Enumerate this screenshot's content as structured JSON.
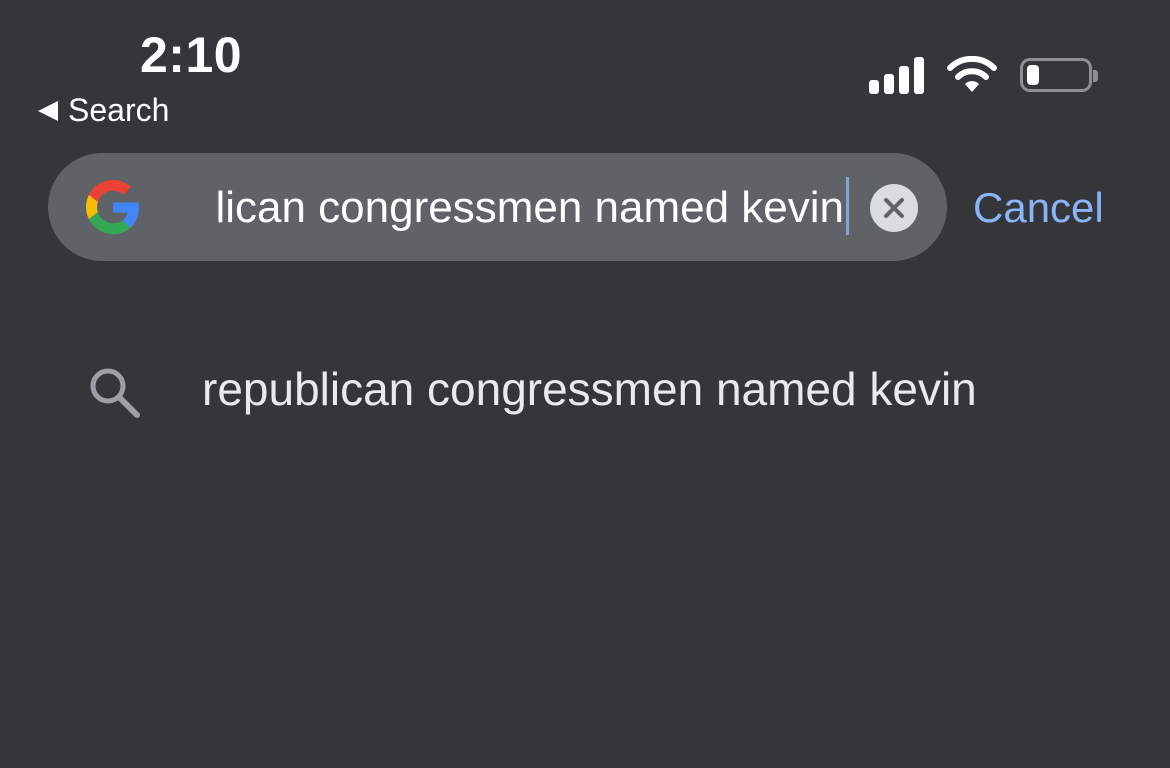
{
  "status_bar": {
    "time": "2:10",
    "back_label": "Search",
    "battery_level": 0.2
  },
  "search": {
    "engine_icon": "google-g-icon",
    "query_visible": "lican congressmen named kevin",
    "clear_icon": "clear-x-icon",
    "cancel_label": "Cancel"
  },
  "suggestions": [
    {
      "icon": "search-icon",
      "text": "republican congressmen named kevin"
    }
  ],
  "colors": {
    "background": "#35363a",
    "search_field": "#5f6368",
    "accent": "#8ab4f8"
  }
}
